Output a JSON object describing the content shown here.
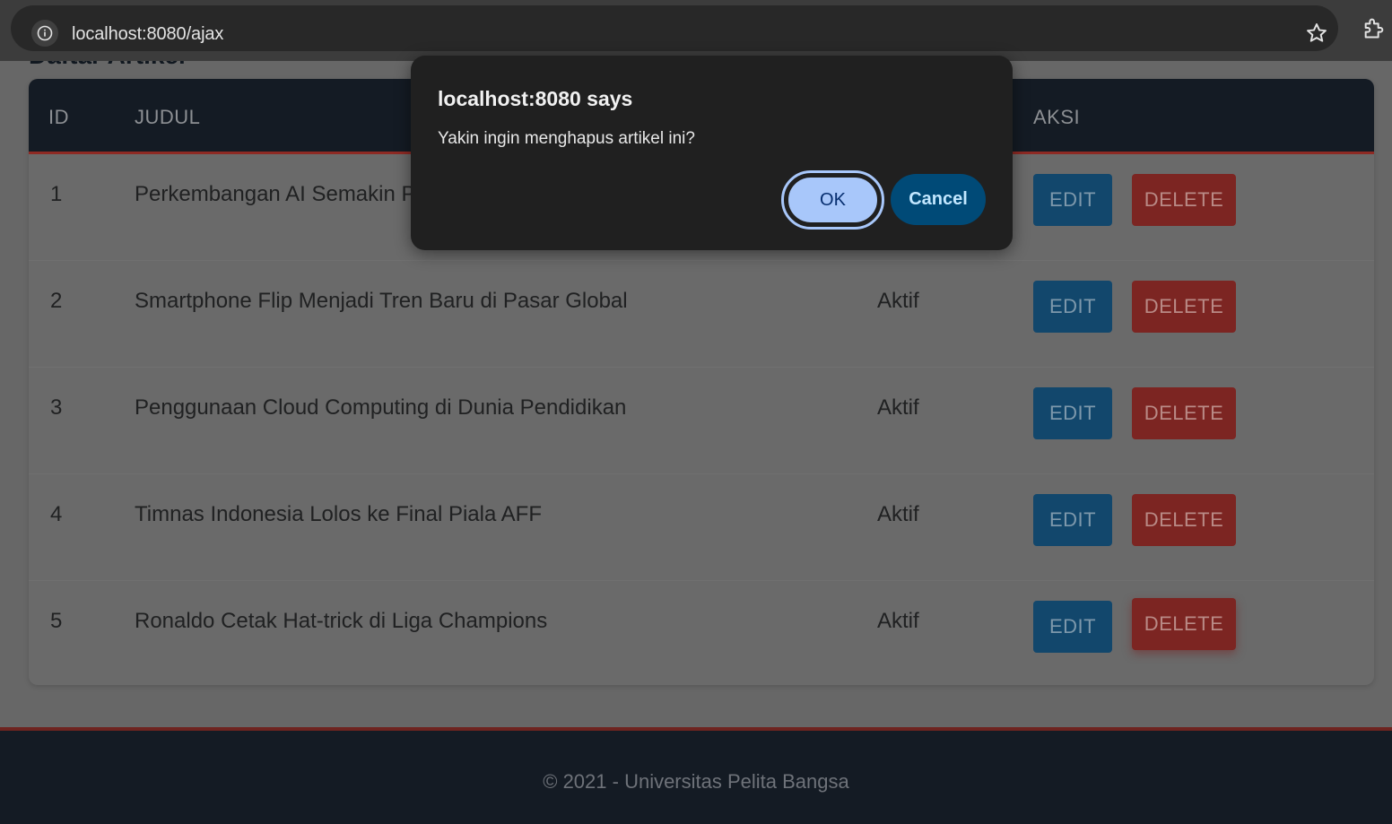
{
  "browser": {
    "url": "localhost:8080/ajax"
  },
  "page": {
    "section_title": "Daftar Artikel",
    "table": {
      "headers": {
        "id": "ID",
        "judul": "JUDUL",
        "aksi": "AKSI"
      },
      "rows": [
        {
          "id": "1",
          "judul": "Perkembangan AI Semakin Pe",
          "status": "",
          "edit": "EDIT",
          "delete": "DELETE"
        },
        {
          "id": "2",
          "judul": "Smartphone Flip Menjadi Tren Baru di Pasar Global",
          "status": "Aktif",
          "edit": "EDIT",
          "delete": "DELETE"
        },
        {
          "id": "3",
          "judul": "Penggunaan Cloud Computing di Dunia Pendidikan",
          "status": "Aktif",
          "edit": "EDIT",
          "delete": "DELETE"
        },
        {
          "id": "4",
          "judul": "Timnas Indonesia Lolos ke Final Piala AFF",
          "status": "Aktif",
          "edit": "EDIT",
          "delete": "DELETE"
        },
        {
          "id": "5",
          "judul": "Ronaldo Cetak Hat-trick di Liga Champions",
          "status": "Aktif",
          "edit": "EDIT",
          "delete": "DELETE"
        }
      ]
    },
    "footer": "© 2021 - Universitas Pelita Bangsa"
  },
  "dialog": {
    "title": "localhost:8080 says",
    "message": "Yakin ingin menghapus artikel ini?",
    "ok_label": "OK",
    "cancel_label": "Cancel"
  },
  "colors": {
    "header_bg": "#141b24",
    "accent_red": "#8e2a24",
    "edit_btn": "#12476c",
    "delete_btn": "#7c2522",
    "dialog_bg": "#202020",
    "ok_btn": "#a8c7fa",
    "cancel_btn": "#004a77"
  },
  "icons": [
    "info-icon",
    "star-icon",
    "extension-icon"
  ]
}
